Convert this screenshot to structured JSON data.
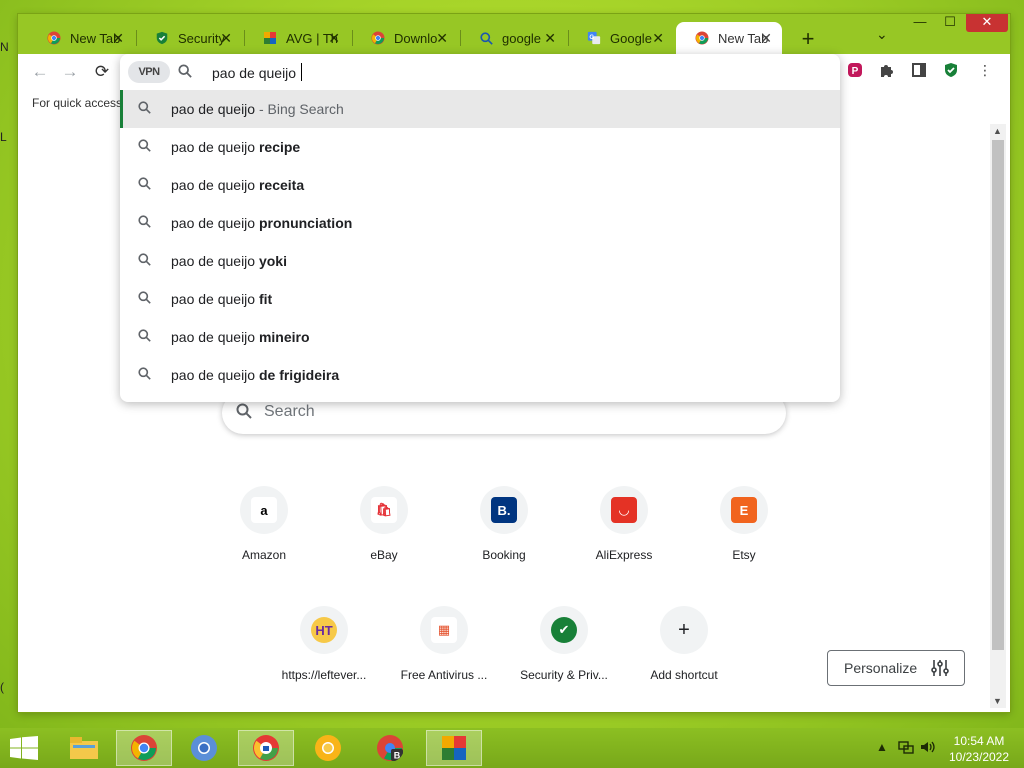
{
  "desktop": {
    "left_fragment": [
      "N",
      "L",
      "("
    ]
  },
  "window": {
    "controls": {
      "minimize": "—",
      "maximize": "☐",
      "close": "✕"
    },
    "tabs": [
      {
        "title": "New Tab",
        "icon": "chrome-icon",
        "active": false
      },
      {
        "title": "Security",
        "icon": "shield-icon",
        "active": false
      },
      {
        "title": "AVG | Th",
        "icon": "avg-icon",
        "active": false
      },
      {
        "title": "Downlo",
        "icon": "chrome-icon",
        "active": false
      },
      {
        "title": "google",
        "icon": "search-icon",
        "active": false
      },
      {
        "title": "Google",
        "icon": "google-translate-icon",
        "active": false
      },
      {
        "title": "New Tab",
        "icon": "chrome-icon",
        "active": true
      }
    ],
    "new_tab_symbol": "+",
    "tab_search_symbol": "⌄"
  },
  "toolbar": {
    "back": "←",
    "forward": "→",
    "reload": "⟳",
    "vpn_label": "VPN",
    "extensions": [
      "pocket-icon",
      "puzzle-icon",
      "sidepanel-icon",
      "shield-icon",
      "menu-icon"
    ]
  },
  "bookmark_bar_hint": "For quick access,",
  "omnibox": {
    "value": "pao de queijo",
    "suggestions": [
      {
        "prefix": "pao de queijo",
        "bold": "",
        "hint": " - Bing Search",
        "selected": true
      },
      {
        "prefix": "pao de queijo ",
        "bold": "recipe",
        "hint": "",
        "selected": false
      },
      {
        "prefix": "pao de queijo ",
        "bold": "receita",
        "hint": "",
        "selected": false
      },
      {
        "prefix": "pao de queijo ",
        "bold": "pronunciation",
        "hint": "",
        "selected": false
      },
      {
        "prefix": "pao de queijo ",
        "bold": "yoki",
        "hint": "",
        "selected": false
      },
      {
        "prefix": "pao de queijo ",
        "bold": "fit",
        "hint": "",
        "selected": false
      },
      {
        "prefix": "pao de queijo ",
        "bold": "mineiro",
        "hint": "",
        "selected": false
      },
      {
        "prefix": "pao de queijo ",
        "bold": "de frigideira",
        "hint": "",
        "selected": false
      }
    ]
  },
  "ntp": {
    "search_placeholder": "Search",
    "shortcuts_row1": [
      {
        "label": "Amazon",
        "glyph": "a",
        "color": "#000000"
      },
      {
        "label": "eBay",
        "glyph": "🛍",
        "color": "#e53238"
      },
      {
        "label": "Booking",
        "glyph": "B.",
        "color": "#ffffff"
      },
      {
        "label": "AliExpress",
        "glyph": "◡",
        "color": "#ffffff"
      },
      {
        "label": "Etsy",
        "glyph": "E",
        "color": "#ffffff"
      }
    ],
    "shortcuts_row2": [
      {
        "label": "https://leftever...",
        "glyph": "HT",
        "color": "#6a2ca0"
      },
      {
        "label": "Free Antivirus ...",
        "glyph": "▦",
        "color": "#e34c26"
      },
      {
        "label": "Security & Priv...",
        "glyph": "✔",
        "color": "#ffffff"
      },
      {
        "label": "Add shortcut",
        "glyph": "+",
        "color": "#202124"
      }
    ],
    "personalize_label": "Personalize"
  },
  "taskbar": {
    "clock_time": "10:54 AM",
    "clock_date": "10/23/2022"
  },
  "colors": {
    "desktop": "#a9d62a",
    "tabstrip": "#97c725",
    "selected_bar": "#188038"
  }
}
